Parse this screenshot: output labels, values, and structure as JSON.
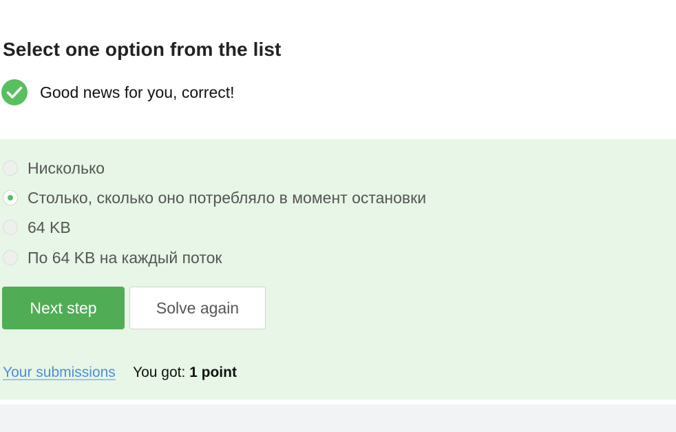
{
  "title": "Select one option from the list",
  "feedback": {
    "icon": "check-circle-icon",
    "icon_color": "#59bf5f",
    "message": "Good news for you, correct!"
  },
  "options": [
    {
      "label": "Нисколько",
      "selected": false
    },
    {
      "label": "Столько, сколько оно потребляло в момент остановки",
      "selected": true
    },
    {
      "label": "64 KB",
      "selected": false
    },
    {
      "label": "По 64 KB на каждый поток",
      "selected": false
    }
  ],
  "buttons": {
    "next_label": "Next step",
    "solve_again_label": "Solve again"
  },
  "submissions_link": "Your submissions",
  "score": {
    "prefix": "You got: ",
    "value": "1 point"
  },
  "colors": {
    "panel_background": "#e7f6e6",
    "accent_green": "#51ad55",
    "link_blue": "#4b8fd9"
  }
}
